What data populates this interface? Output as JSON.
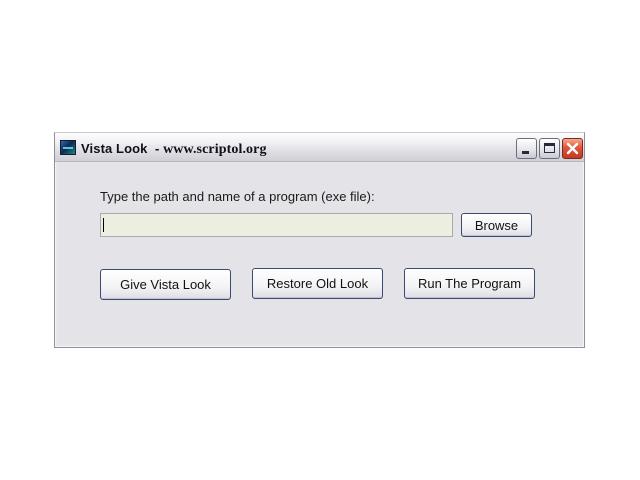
{
  "window": {
    "title_app": "Vista Look",
    "title_sep": "  - ",
    "title_url": "www.scriptol.org"
  },
  "form": {
    "prompt": "Type the path and name of a program (exe file):",
    "path_value": "",
    "path_placeholder": ""
  },
  "buttons": {
    "browse": "Browse",
    "give_vista_look": "Give Vista Look",
    "restore_old_look": "Restore Old Look",
    "run_program": "Run The Program"
  },
  "colors": {
    "input_background": "#ecefdf",
    "close_button": "#e0553a",
    "window_background": "#e4e4e8"
  },
  "icons": {
    "app": "vista-look-app-icon",
    "minimize": "minimize-icon",
    "maximize": "maximize-icon",
    "close": "close-icon"
  }
}
